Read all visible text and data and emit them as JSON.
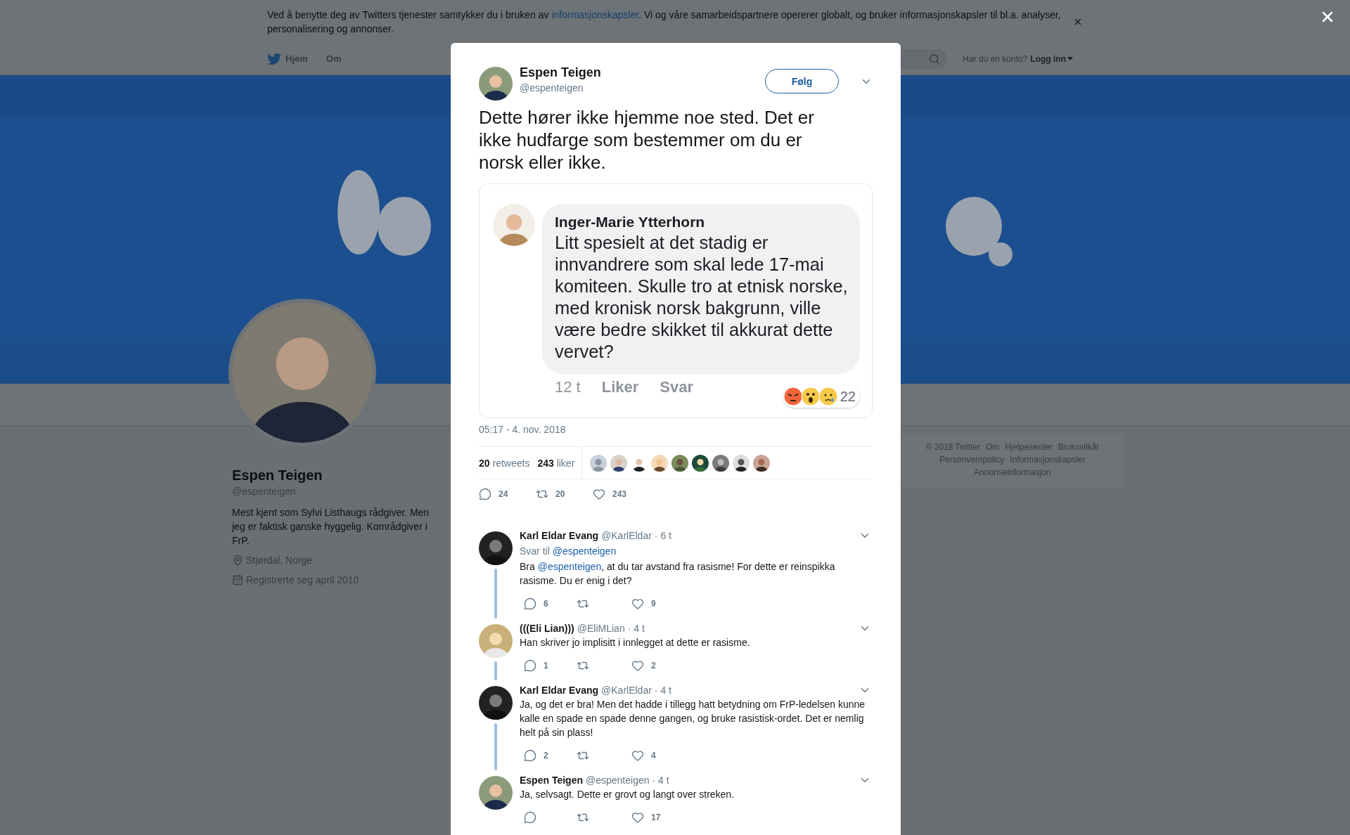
{
  "cookie_banner": {
    "text_before": "Ved å benytte deg av Twitters tjenester samtykker du i bruken av ",
    "link": "informasjonskapsler",
    "text_after": ". Vi og våre samarbeidspartnere opererer globalt, og bruker informasjonskapsler til bl.a. analyser, personalisering og annonser."
  },
  "nav": {
    "items": [
      {
        "label": "Hjem",
        "kind": "home"
      },
      {
        "label": "Om",
        "kind": "plain"
      }
    ],
    "account_prompt": "Har du en konto?",
    "login": "Logg inn"
  },
  "profile": {
    "name": "Espen Teigen",
    "handle": "@espenteigen",
    "bio": "Mest kjent som Sylvi Listhaugs rådgiver. Men jeg er faktisk ganske hyggelig. Kområdgiver i FrP.",
    "location": "Stjørdal, Norge",
    "joined": "Registrerte seg april 2010"
  },
  "footer_links": [
    "© 2018 Twitter",
    "Om",
    "Hjelpesenter",
    "Bruksvilkår",
    "Personvernpolicy",
    "Informasjonskapsler",
    "Annonseinformasjon"
  ],
  "tweet": {
    "author": {
      "name": "Espen Teigen",
      "handle": "@espenteigen"
    },
    "follow": "Følg",
    "text": "Dette hører ikke hjemme noe sted. Det er ikke hudfarge som bestemmer om du er norsk eller ikke.",
    "media": {
      "kind": "screenshot",
      "author": "Inger-Marie Ytterhorn",
      "text": "Litt spesielt at det stadig er innvandrere som skal lede 17-mai komiteen. Skulle tro at etnisk norske, med kronisk norsk bakgrunn, ville være bedre skikket til akkurat dette vervet?",
      "time": "12 t",
      "actions": [
        "Liker",
        "Svar"
      ],
      "reactions": "22"
    },
    "timestamp": "05:17 - 4. nov. 2018",
    "retweets": "**20** retweets",
    "likes": "**243** liker",
    "counts": {
      "reply": "24",
      "retweet": "20",
      "like": "243"
    }
  },
  "replies": [
    {
      "name": "Karl Eldar Evang",
      "handle": "@KarlEldar",
      "time": "· 6 t",
      "reply_to": {
        "label": "Svar til",
        "mention": "@espenteigen"
      },
      "parts": [
        {
          "kind": "text",
          "text": "Bra "
        },
        {
          "kind": "mention",
          "text": "@espenteigen"
        },
        {
          "kind": "text",
          "text": ", at du tar avstand fra rasisme! For dette er reinspikka rasisme. Du er enig i det?"
        }
      ],
      "counts": {
        "reply": "6",
        "like": "9"
      },
      "thread_continues": true
    },
    {
      "name": "(((Eli Lian)))",
      "handle": "@EliMLian",
      "time": "· 4 t",
      "parts": [
        {
          "kind": "text",
          "text": "Han skriver jo implisitt i innlegget at dette er rasisme."
        }
      ],
      "counts": {
        "reply": "1",
        "like": "2"
      },
      "thread_continues": true
    },
    {
      "name": "Karl Eldar Evang",
      "handle": "@KarlEldar",
      "time": "· 4 t",
      "parts": [
        {
          "kind": "text",
          "text": "Ja, og det er bra! Men det hadde i tillegg hatt betydning om FrP-ledelsen kunne kalle en spade en spade denne gangen, og bruke rasistisk-ordet. Det er nemlig helt på sin plass!"
        }
      ],
      "counts": {
        "reply": "2",
        "like": "4"
      },
      "thread_continues": true
    },
    {
      "name": "Espen Teigen",
      "handle": "@espenteigen",
      "time": "· 4 t",
      "parts": [
        {
          "kind": "text",
          "text": "Ja, selvsagt. Dette er grovt og langt over streken."
        }
      ],
      "counts": {
        "like": "17"
      },
      "thread_continues": false
    }
  ]
}
